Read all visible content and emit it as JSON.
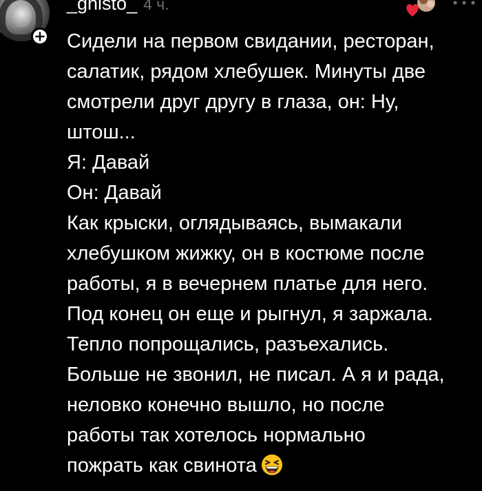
{
  "comment": {
    "username": "_ghisto_",
    "time": "4 ч.",
    "icons": {
      "avatar": "user-avatar",
      "add": "plus-icon",
      "reaction": "heart-reaction-icon",
      "more": "more-dots-icon",
      "emoji": "grinning-squinting-face-emoji"
    },
    "lines": [
      "Сидели на первом свидании, ресторан,",
      "салатик, рядом хлебушек. Минуты две",
      "смотрели друг другу в глаза, он: Ну,",
      "штош...",
      "Я: Давай",
      "Он: Давай",
      "Как крыски, оглядываясь, вымакали",
      "хлебушком жижку, он в костюме после",
      "работы, я в вечернем платье для него.",
      "Под конец он еще и рыгнул, я заржала.",
      "Тепло попрощались, разъехались.",
      "Больше не звонил, не писал. А я и рада,",
      "неловко конечно вышло, но после",
      "работы так хотелось нормально",
      "пожрать как свинота"
    ]
  }
}
